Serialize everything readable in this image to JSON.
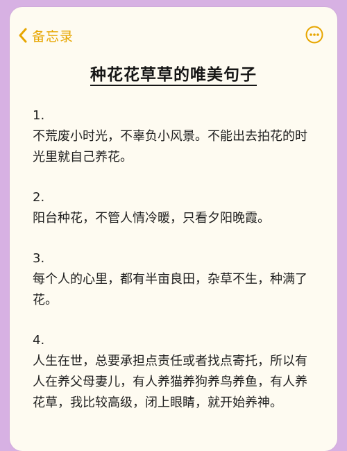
{
  "nav": {
    "back_label": "备忘录",
    "back_icon": "chevron-left-icon",
    "more_icon": "more-horizontal-icon",
    "accent_color": "#e7a600"
  },
  "note": {
    "title": "种花花草草的唯美句子",
    "items": [
      {
        "number": "1.",
        "text": "不荒废小时光，不辜负小风景。不能出去拍花的时光里就自己养花。"
      },
      {
        "number": "2.",
        "text": "阳台种花，不管人情冷暖，只看夕阳晚霞。"
      },
      {
        "number": "3.",
        "text": "每个人的心里，都有半亩良田，杂草不生，种满了花。"
      },
      {
        "number": "4.",
        "text": "人生在世，总要承担点责任或者找点寄托，所以有人在养父母妻儿，有人养猫养狗养鸟养鱼，有人养花草，我比较高级，闭上眼睛，就开始养神。"
      }
    ]
  }
}
